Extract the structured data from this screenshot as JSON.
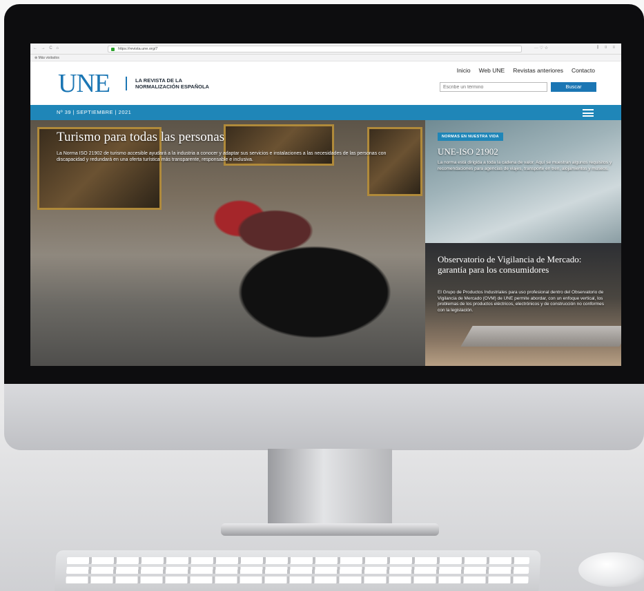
{
  "browser": {
    "nav_glyphs": "← → C ⌂",
    "url": "https://revista.une.org/7",
    "menu": "··· ♡ ☆",
    "right_icons": "⫼ ▯ ≡",
    "bookmarks": "⊕ Más visitados"
  },
  "header": {
    "logo": "UNE",
    "tagline_line1": "LA REVISTA DE LA",
    "tagline_line2": "NORMALIZACIÓN ESPAÑOLA",
    "nav": [
      "Inicio",
      "Web UNE",
      "Revistas anteriores",
      "Contacto"
    ],
    "search_placeholder": "Escribe un término",
    "search_button": "Buscar"
  },
  "issue_bar": {
    "label": "Nº 39 | SEPTIEMBRE | 2021"
  },
  "hero": {
    "title": "Turismo para todas las personas",
    "text": "La Norma ISO 21902 de turismo accesible ayudará a la industria a conocer y adaptar sus servicios e instalaciones a las necesidades de las personas con discapacidad y redundará en una oferta turística más transparente, responsable e inclusiva."
  },
  "side_top": {
    "badge": "NORMAS EN NUESTRA VIDA",
    "title": "UNE-ISO 21902",
    "text": "La norma está dirigida a toda la cadena de valor. Aquí se muestran algunos requisitos y recomendaciones para agencias de viajes, transporte en tren, alojamientos y museos."
  },
  "side_bottom": {
    "title": "Observatorio de Vigilancia de Mercado: garantía para los consumidores",
    "text": "El Grupo de Productos Industriales para uso profesional dentro del Observatorio de Vigilancia de Mercado (OVM) de UNE permite abordar, con un enfoque vertical, los problemas de los productos eléctricos, electrónicos y de construcción no conformes con la legislación."
  },
  "colors": {
    "brand_blue": "#1b76b4",
    "bar_blue": "#1f86b8",
    "bezel": "#0d0d0f"
  },
  "icons": [
    "back-icon",
    "forward-icon",
    "reload-icon",
    "home-icon",
    "lock-icon",
    "bookmark-icon",
    "hamburger-icon"
  ]
}
